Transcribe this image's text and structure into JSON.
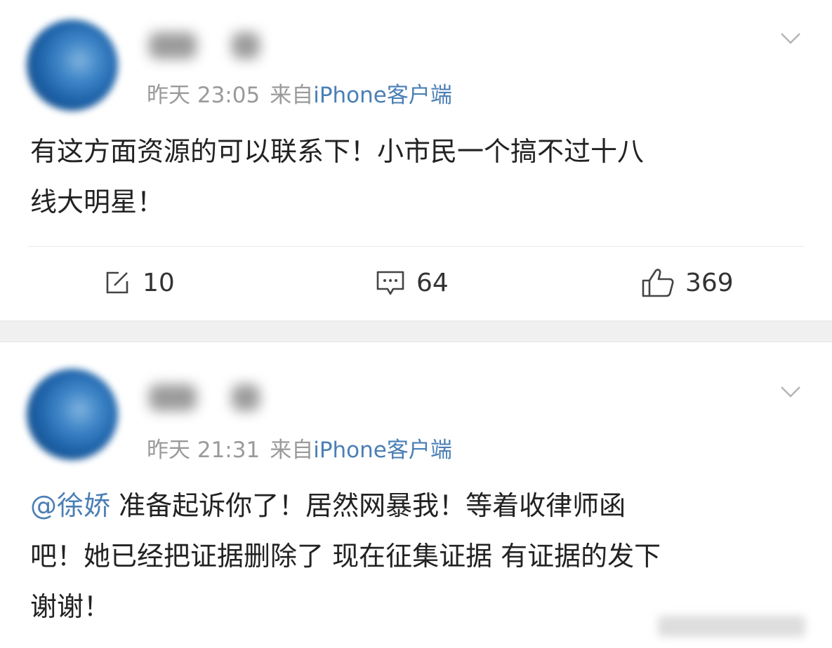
{
  "posts": [
    {
      "timestamp": "昨天 23:05",
      "source_prefix": "来自",
      "source_app": "iPhone客户端",
      "body_lines": [
        "有这方面资源的可以联系下！小市民一个搞不过十八",
        "线大明星！"
      ],
      "actions": {
        "repost_count": "10",
        "comment_count": "64",
        "like_count": "369"
      }
    },
    {
      "timestamp": "昨天 21:31",
      "source_prefix": "来自",
      "source_app": "iPhone客户端",
      "mention": "@徐娇",
      "body_first": " 准备起诉你了！居然网暴我！等着收律师函",
      "body_lines": [
        "吧！她已经把证据删除了 现在征集证据 有证据的发下",
        "谢谢！"
      ]
    }
  ],
  "icons": {
    "repost": "edit-square-icon",
    "comment": "comment-bubble-icon",
    "like": "thumbs-up-icon",
    "menu": "chevron-down-icon"
  },
  "colors": {
    "link": "#4a7fb5",
    "meta": "#9a9a9a",
    "text": "#222222",
    "separator": "#f0f0f0"
  }
}
